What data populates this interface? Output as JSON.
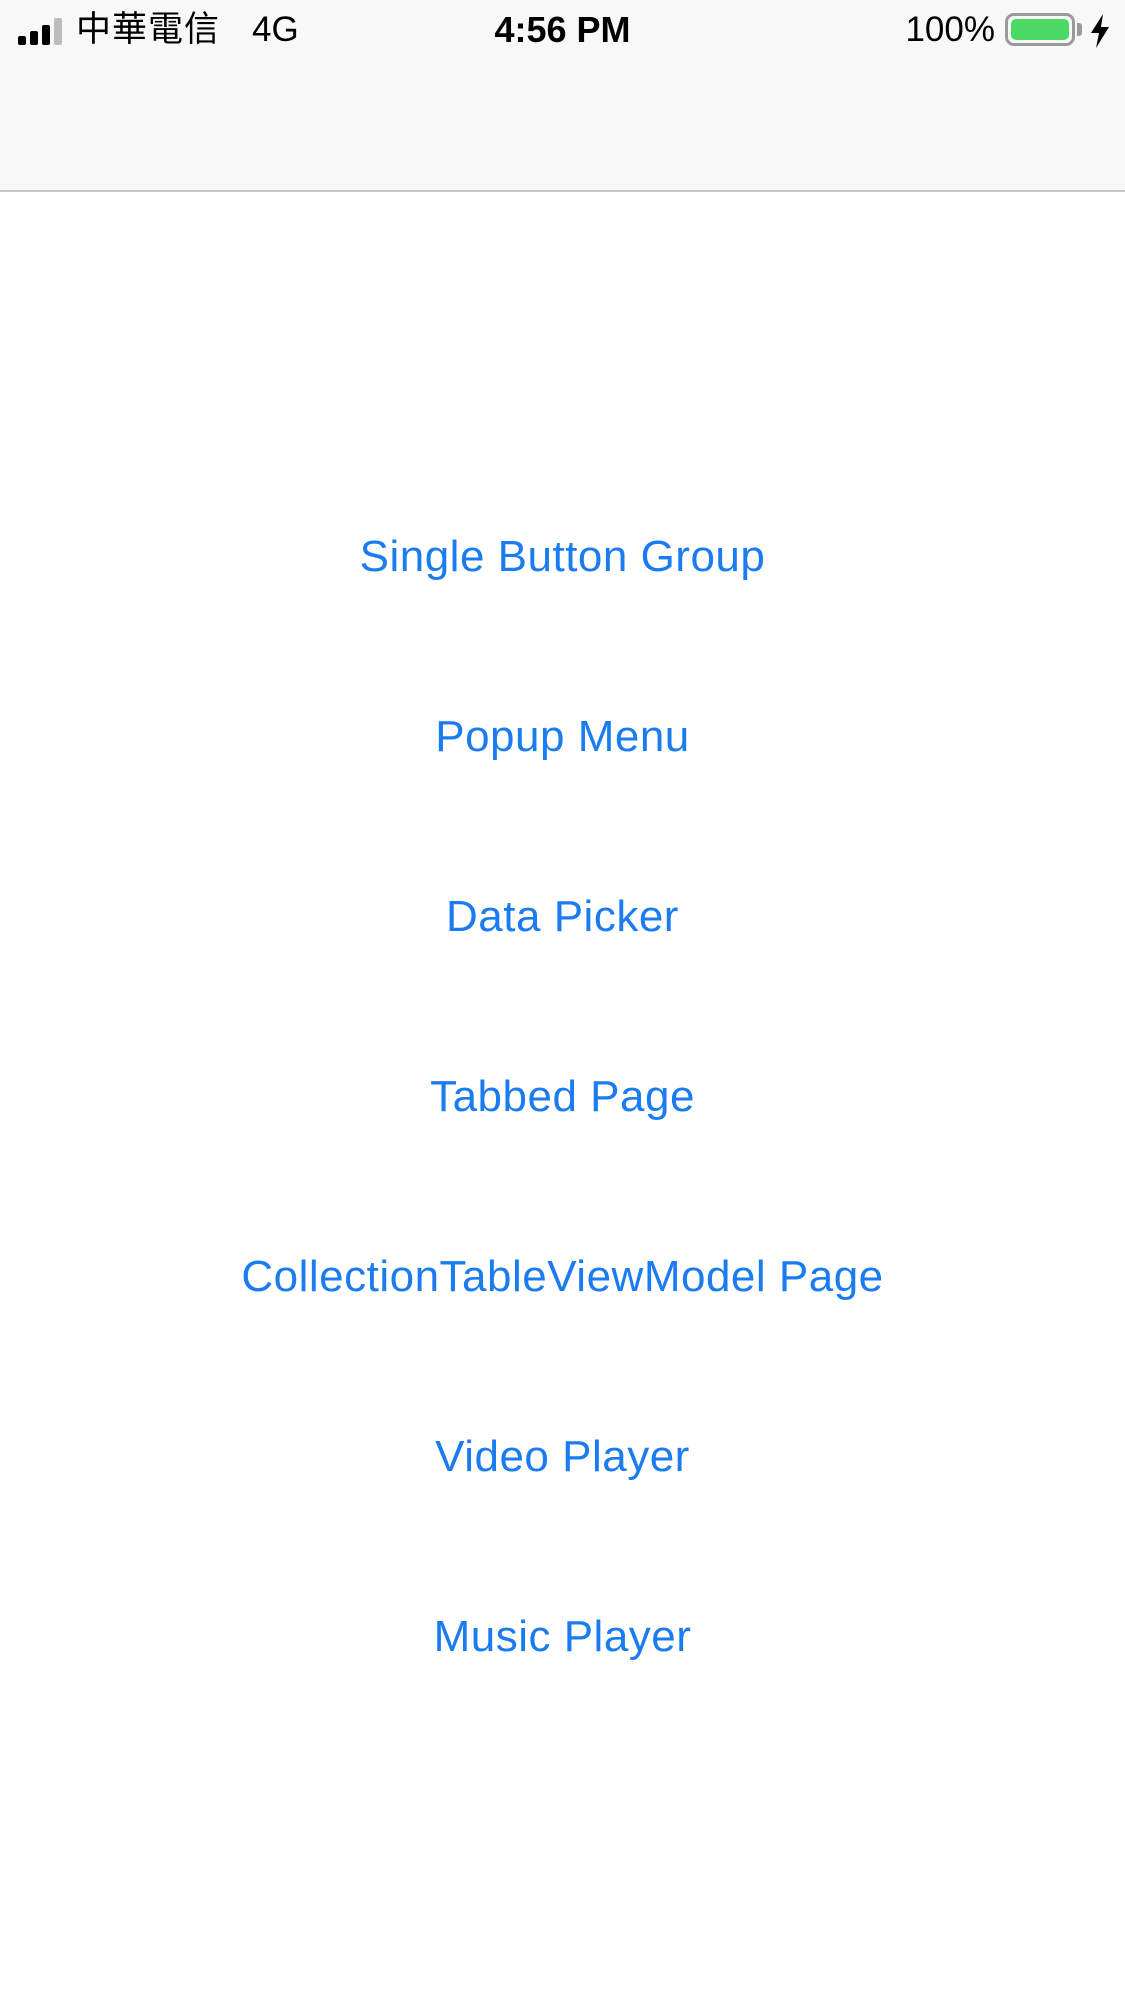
{
  "status_bar": {
    "carrier": "中華電信",
    "network": "4G",
    "time": "4:56 PM",
    "battery_percent": "100%",
    "battery_level": 1.0,
    "signal_bars_filled": 3,
    "signal_bars_total": 4,
    "charging": true,
    "icons": {
      "signal": "signal-strength-icon",
      "battery": "battery-icon",
      "charging": "charging-bolt-icon"
    }
  },
  "menu": {
    "items": [
      {
        "label": "Single Button Group"
      },
      {
        "label": "Popup Menu"
      },
      {
        "label": "Data Picker"
      },
      {
        "label": "Tabbed Page"
      },
      {
        "label": "CollectionTableViewModel Page"
      },
      {
        "label": "Video Player"
      },
      {
        "label": "Music Player"
      }
    ]
  },
  "colors": {
    "link": "#1a7cf0",
    "nav_background": "#f8f8f8",
    "battery_fill": "#4cd964"
  }
}
